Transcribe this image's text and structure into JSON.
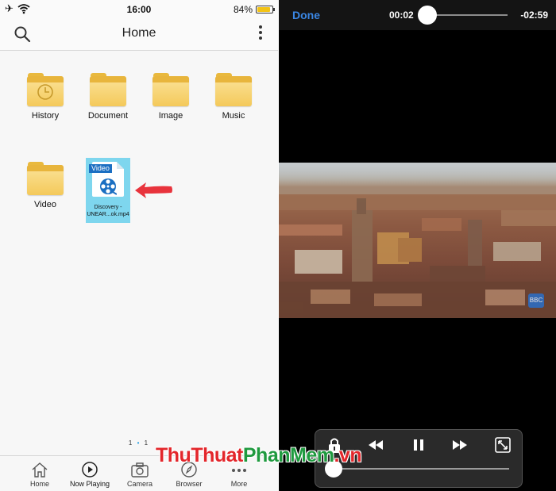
{
  "left": {
    "status": {
      "time": "16:00",
      "battery": "84%"
    },
    "navbar": {
      "title": "Home"
    },
    "folders": [
      "History",
      "Document",
      "Image",
      "Music",
      "Video"
    ],
    "file": {
      "tag": "Video",
      "name_line1": "Discovery -",
      "name_line2": "UNEAR...ok.mp4"
    },
    "pager": {
      "left": "1",
      "right": "1"
    },
    "tabs": [
      "Home",
      "Now Playing",
      "Camera",
      "Browser",
      "More"
    ]
  },
  "right": {
    "done_label": "Done",
    "elapsed": "00:02",
    "remaining": "-02:59",
    "watermark": "BBC"
  },
  "brand": {
    "part1": "Thu",
    "part2": "Thuat",
    "part3": "Phan",
    "part4": "Mem",
    "part5": ".vn"
  },
  "colors": {
    "accent": "#1c9be0",
    "done": "#3a86e3",
    "folder": "#f4c95a",
    "selected": "#7ed6ee",
    "arrow": "#e8333c",
    "brand_red": "#e3262b",
    "brand_green": "#1f9a3f"
  }
}
